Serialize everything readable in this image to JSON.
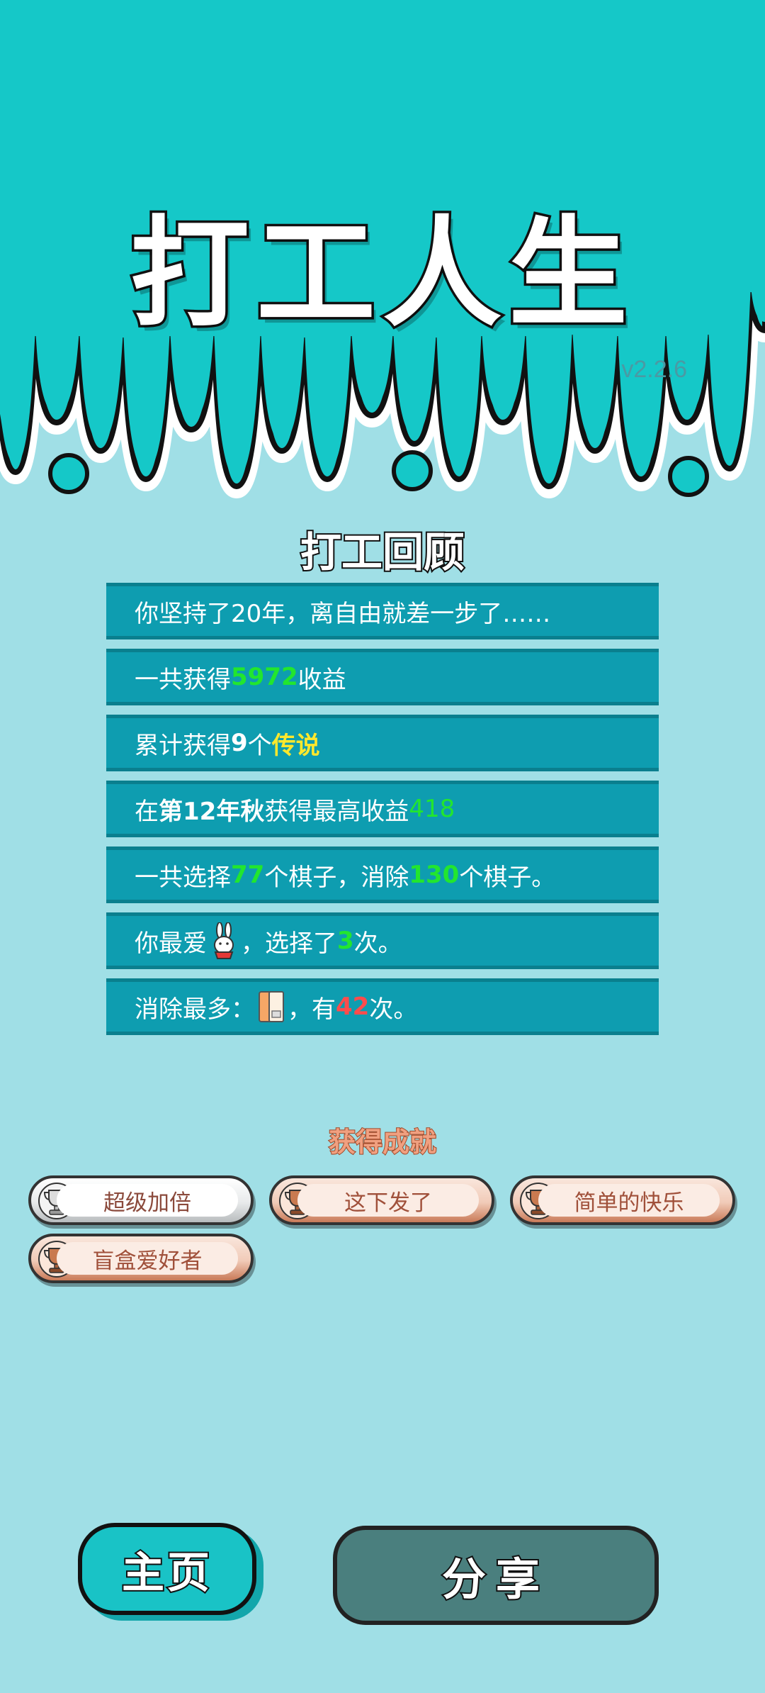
{
  "header": {
    "title": "打工人生",
    "version": "v2.2.6"
  },
  "review": {
    "title": "打工回顾",
    "rows": [
      {
        "text": "你坚持了20年，离自由就差一步了……"
      },
      {
        "pre": "一共获得",
        "value": "5972",
        "post": "收益"
      },
      {
        "pre": "累计获得",
        "count": "9",
        "mid": "个",
        "label": "传说"
      },
      {
        "pre": "在 ",
        "season": "第12年秋",
        "mid": " 获得最高收益",
        "value": "418"
      },
      {
        "pre": "一共选择",
        "chosen": "77",
        "mid": "个棋子，消除",
        "removed": "130",
        "post": "个棋子。"
      },
      {
        "pre": "你最爱",
        "icon": "rabbit-icon",
        "mid": "，选择了",
        "times": "3",
        "post": "次。"
      },
      {
        "pre": "消除最多：",
        "icon": "book-icon",
        "mid": "，有",
        "times": "42",
        "post": "次。"
      }
    ]
  },
  "achievements": {
    "title": "获得成就",
    "items": [
      {
        "label": "超级加倍",
        "tier": "silver"
      },
      {
        "label": "这下发了",
        "tier": "bronze"
      },
      {
        "label": "简单的快乐",
        "tier": "bronze"
      },
      {
        "label": "盲盒爱好者",
        "tier": "bronze"
      }
    ]
  },
  "buttons": {
    "home": "主页",
    "share": "分享"
  },
  "colors": {
    "top_band": "#15c8c8",
    "background": "#a0dfe6",
    "row": "#0e9db0",
    "highlight_green": "#22e62e",
    "highlight_yellow": "#ffe82c",
    "highlight_red": "#ff4c4c"
  }
}
